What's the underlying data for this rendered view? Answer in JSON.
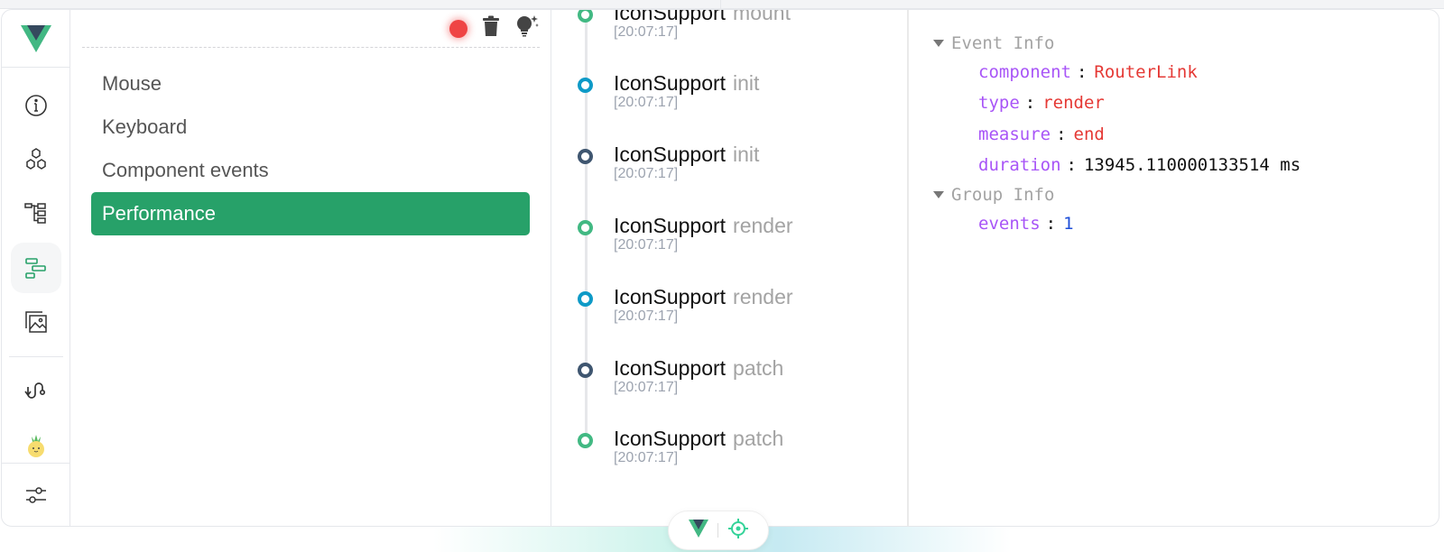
{
  "app": {
    "name": "Vue DevTools"
  },
  "colors": {
    "accent": "#27a169",
    "record": "#ef4444",
    "dot_blue": "#0e9ac7",
    "dot_navy": "#3f5670",
    "dot_green": "#42b983",
    "key": "#a855f7",
    "string_value": "#e53935",
    "number_value": "#1d4ed8"
  },
  "rail": {
    "logo": "vue-logo",
    "items": [
      {
        "icon": "info-icon",
        "label": "Overview"
      },
      {
        "icon": "components-icon",
        "label": "Components"
      },
      {
        "icon": "tree-icon",
        "label": "Component tree"
      },
      {
        "icon": "timeline-icon",
        "label": "Timeline",
        "active": true
      },
      {
        "icon": "assets-icon",
        "label": "Assets"
      },
      {
        "icon": "router-icon",
        "label": "Router"
      },
      {
        "icon": "pinia-icon",
        "label": "Pinia"
      },
      {
        "icon": "settings-icon",
        "label": "Settings"
      }
    ]
  },
  "toolbar": {
    "record": "Recording",
    "clear": "Clear",
    "tips": "Tips"
  },
  "categories": [
    {
      "label": "Mouse",
      "selected": false
    },
    {
      "label": "Keyboard",
      "selected": false
    },
    {
      "label": "Component events",
      "selected": false
    },
    {
      "label": "Performance",
      "selected": true
    }
  ],
  "timeline": {
    "events": [
      {
        "name": "IconSupport",
        "kind": "mount",
        "time": "[20:07:17]",
        "color": "dot_green",
        "partial": true
      },
      {
        "name": "IconSupport",
        "kind": "init",
        "time": "[20:07:17]",
        "color": "dot_blue"
      },
      {
        "name": "IconSupport",
        "kind": "init",
        "time": "[20:07:17]",
        "color": "dot_navy"
      },
      {
        "name": "IconSupport",
        "kind": "render",
        "time": "[20:07:17]",
        "color": "dot_green"
      },
      {
        "name": "IconSupport",
        "kind": "render",
        "time": "[20:07:17]",
        "color": "dot_blue"
      },
      {
        "name": "IconSupport",
        "kind": "patch",
        "time": "[20:07:17]",
        "color": "dot_navy"
      },
      {
        "name": "IconSupport",
        "kind": "patch",
        "time": "[20:07:17]",
        "color": "dot_green"
      }
    ]
  },
  "inspector": {
    "event_info": {
      "title": "Event Info",
      "props": [
        {
          "key": "component",
          "value": "RouterLink",
          "type": "string"
        },
        {
          "key": "type",
          "value": "render",
          "type": "string"
        },
        {
          "key": "measure",
          "value": "end",
          "type": "string"
        },
        {
          "key": "duration",
          "value": "13945.110000133514 ms",
          "type": "plain"
        }
      ]
    },
    "group_info": {
      "title": "Group Info",
      "props": [
        {
          "key": "events",
          "value": "1",
          "type": "number"
        }
      ]
    }
  },
  "floating_bar": {
    "logo": "vue-logo",
    "inspect": "Inspect component"
  }
}
